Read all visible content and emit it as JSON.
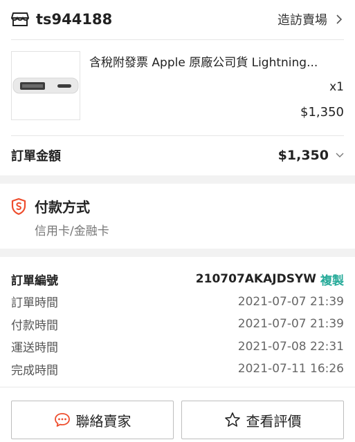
{
  "shop": {
    "name": "ts944188",
    "visit_label": "造訪賣場"
  },
  "product": {
    "title": "含稅附發票 Apple 原廠公司貨 Lightning...",
    "quantity": "x1",
    "price": "$1,350"
  },
  "order_total": {
    "label": "訂單金額",
    "value": "$1,350"
  },
  "payment": {
    "title": "付款方式",
    "method": "信用卡/金融卡"
  },
  "order_info": {
    "order_no_label": "訂單編號",
    "order_no": "210707AKAJDSYW",
    "copy_label": "複製",
    "rows": [
      {
        "label": "訂單時間",
        "value": "2021-07-07 21:39"
      },
      {
        "label": "付款時間",
        "value": "2021-07-07 21:39"
      },
      {
        "label": "運送時間",
        "value": "2021-07-08 22:31"
      },
      {
        "label": "完成時間",
        "value": "2021-07-11 16:26"
      }
    ]
  },
  "actions": {
    "contact_seller": "聯絡賣家",
    "view_review": "查看評價"
  },
  "colors": {
    "accent_green": "#26aa99",
    "brand_orange": "#ee4d2d",
    "section_gap": "#f2f2f2"
  },
  "icons": {
    "shop": "shop-icon",
    "chevron": "chevron-right-icon",
    "payment": "shield-icon",
    "chat": "chat-icon",
    "star": "star-icon"
  }
}
